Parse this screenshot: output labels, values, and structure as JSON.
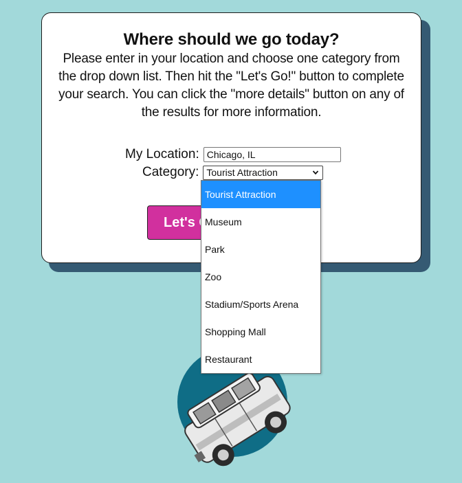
{
  "heading": "Where should we go today?",
  "intro": "Please enter in your location and choose one category from the drop down list. Then hit the \"Let's Go!\" button to complete your search. You can click the \"more details\" button on any of the results for more information.",
  "form": {
    "location_label": "My Location:",
    "location_value": "Chicago, IL",
    "category_label": "Category:",
    "category_selected": "Tourist Attraction",
    "category_options": [
      "Tourist Attraction",
      "Museum",
      "Park",
      "Zoo",
      "Stadium/Sports Arena",
      "Shopping Mall",
      "Restaurant"
    ],
    "submit_label": "Let's Go!"
  },
  "colors": {
    "page_background": "#a2d9da",
    "card_shadow": "#355a73",
    "button": "#d1309e",
    "selected_option": "#1e90ff",
    "illustration_circle": "#0f6d86"
  },
  "icons": {
    "select_arrow": "chevron-down-icon",
    "illustration": "car-illustration"
  }
}
